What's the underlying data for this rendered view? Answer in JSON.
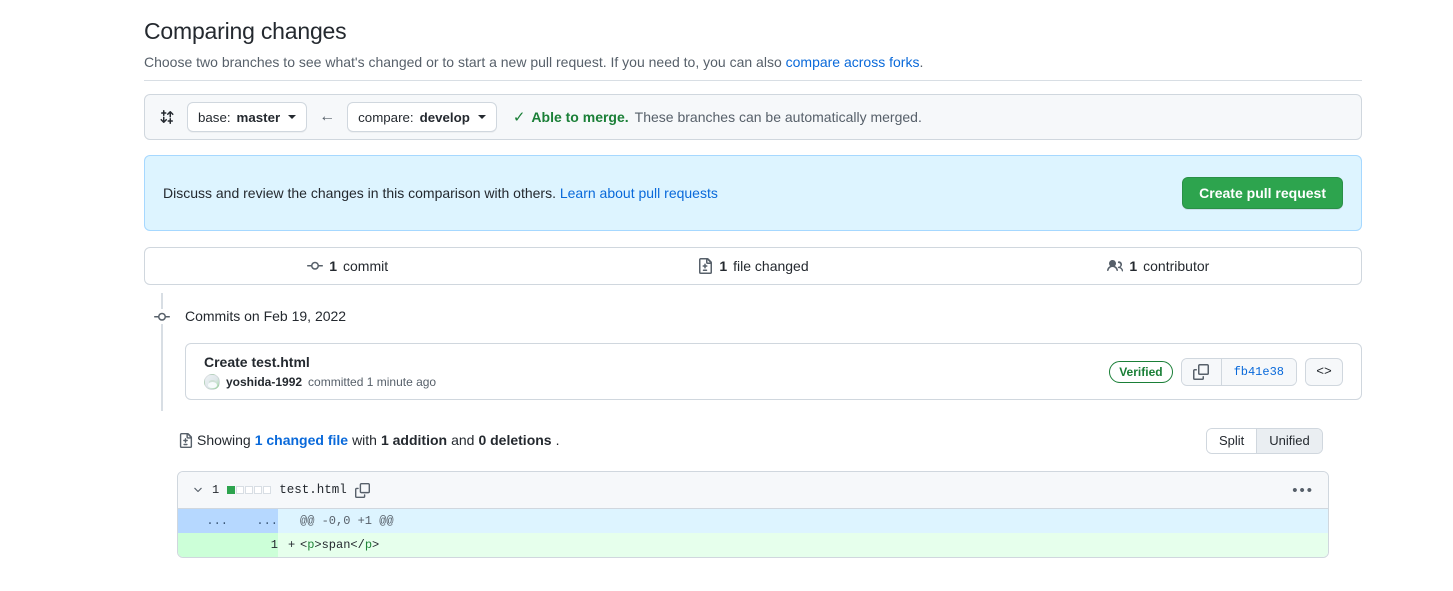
{
  "header": {
    "title": "Comparing changes",
    "subtitle_pre": "Choose two branches to see what's changed or to start a new pull request. If you need to, you can also ",
    "subtitle_link": "compare across forks",
    "subtitle_post": "."
  },
  "branch_bar": {
    "compare_icon": "git-compare-icon",
    "base": {
      "kind": "base:",
      "name": "master"
    },
    "arrow": "←",
    "compare": {
      "kind": "compare:",
      "name": "develop"
    },
    "check_glyph": "✓",
    "status_bold": "Able to merge.",
    "status_rest": " These branches can be automatically merged."
  },
  "banner": {
    "text_pre": "Discuss and review the changes in this comparison with others. ",
    "link": "Learn about pull requests",
    "button": "Create pull request"
  },
  "stats": [
    {
      "icon": "commit-icon",
      "num": "1",
      "label": "commit"
    },
    {
      "icon": "file-diff-icon",
      "num": "1",
      "label": "file changed"
    },
    {
      "icon": "people-icon",
      "num": "1",
      "label": "contributor"
    }
  ],
  "timeline": {
    "node_icon": "commit-node-icon",
    "commits_on": "Commits on Feb 19, 2022",
    "commit": {
      "title": "Create test.html",
      "avatar": "user-avatar",
      "author": "yoshida-1992",
      "meta": "committed 1 minute ago",
      "verified": "Verified",
      "copy_icon": "copy-icon",
      "sha": "fb41e38",
      "code_icon": "<>"
    }
  },
  "showing": {
    "icon": "file-diff-icon",
    "pre": "Showing ",
    "changed_file": "1 changed file",
    "mid": " with ",
    "additions": "1 addition",
    "and": " and ",
    "deletions": "0 deletions",
    "post": ".",
    "toggle": {
      "split": "Split",
      "unified": "Unified",
      "active": "Unified"
    }
  },
  "file": {
    "chevron_icon": "chevron-down-icon",
    "change_count": "1",
    "diffstat": [
      "add",
      "none",
      "none",
      "none",
      "none"
    ],
    "name": "test.html",
    "copy_icon": "copy-path-icon",
    "kebab_icon": "kebab-menu-icon",
    "rows": [
      {
        "type": "hunk",
        "ln_old": "...",
        "ln_new": "...",
        "code": "@@ -0,0 +1 @@"
      },
      {
        "type": "add",
        "ln_old": "",
        "ln_new": "1",
        "marker": "+",
        "code_parts": [
          {
            "t": "<",
            "cls": ""
          },
          {
            "t": "p",
            "cls": "tagname"
          },
          {
            "t": ">span</",
            "cls": ""
          },
          {
            "t": "p",
            "cls": "tagname"
          },
          {
            "t": ">",
            "cls": ""
          }
        ]
      }
    ]
  },
  "colors": {
    "accent_blue": "#0969da",
    "success_green": "#1a7f37",
    "button_green": "#2da44e",
    "banner_blue": "#ddf4ff",
    "add_line_bg": "#e6ffec",
    "hunk_bg": "#ddf4ff",
    "border": "#d0d7de"
  }
}
